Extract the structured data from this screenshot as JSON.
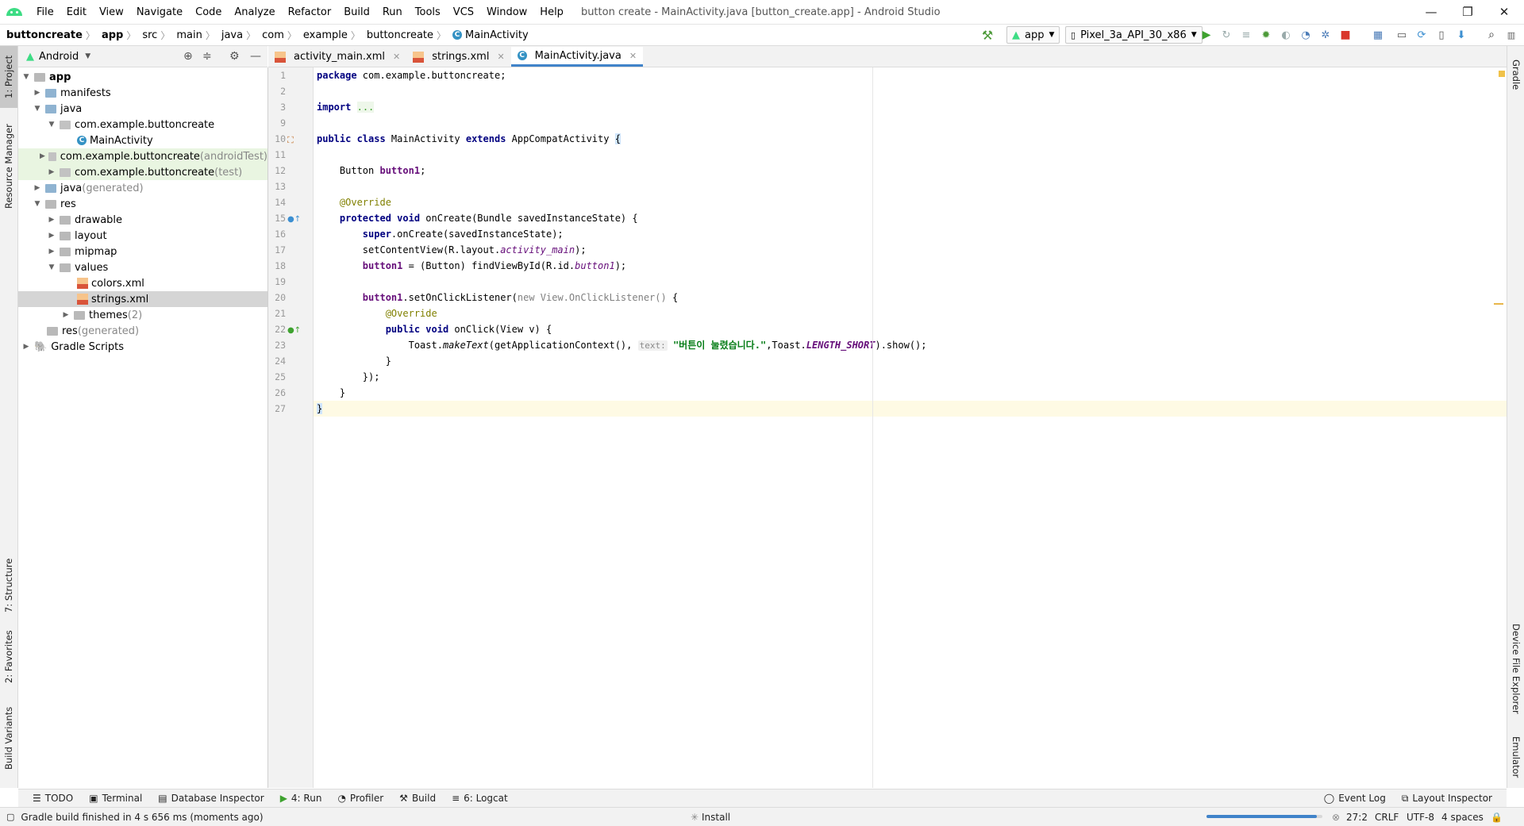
{
  "window": {
    "title": "button create - MainActivity.java [button_create.app] - Android Studio",
    "controls": {
      "minimize": "—",
      "restore": "❐",
      "close": "✕"
    }
  },
  "menu": [
    "File",
    "Edit",
    "View",
    "Navigate",
    "Code",
    "Analyze",
    "Refactor",
    "Build",
    "Run",
    "Tools",
    "VCS",
    "Window",
    "Help"
  ],
  "breadcrumb": [
    "buttoncreate",
    "app",
    "src",
    "main",
    "java",
    "com",
    "example",
    "buttoncreate",
    "MainActivity"
  ],
  "toolbar": {
    "run_config": "app",
    "device": "Pixel_3a_API_30_x86"
  },
  "project_panel": {
    "view_mode": "Android",
    "tree": [
      {
        "label": "app",
        "suffix": "",
        "bold": true
      },
      {
        "label": "manifests",
        "suffix": ""
      },
      {
        "label": "java",
        "suffix": ""
      },
      {
        "label": "com.example.buttoncreate",
        "suffix": ""
      },
      {
        "label": "MainActivity",
        "suffix": ""
      },
      {
        "label": "com.example.buttoncreate",
        "suffix": " (androidTest)"
      },
      {
        "label": "com.example.buttoncreate",
        "suffix": " (test)"
      },
      {
        "label": "java",
        "suffix": " (generated)"
      },
      {
        "label": "res",
        "suffix": ""
      },
      {
        "label": "drawable",
        "suffix": ""
      },
      {
        "label": "layout",
        "suffix": ""
      },
      {
        "label": "mipmap",
        "suffix": ""
      },
      {
        "label": "values",
        "suffix": ""
      },
      {
        "label": "colors.xml",
        "suffix": ""
      },
      {
        "label": "strings.xml",
        "suffix": ""
      },
      {
        "label": "themes",
        "suffix": " (2)"
      },
      {
        "label": "res",
        "suffix": " (generated)"
      },
      {
        "label": "Gradle Scripts",
        "suffix": ""
      }
    ]
  },
  "left_tool_tabs": [
    "1: Project",
    "Resource Manager",
    "7: Structure",
    "2: Favorites",
    "Build Variants"
  ],
  "right_tool_tabs": [
    "Gradle",
    "Device File Explorer",
    "Emulator"
  ],
  "editor_tabs": [
    {
      "label": "activity_main.xml"
    },
    {
      "label": "strings.xml"
    },
    {
      "label": "MainActivity.java",
      "active": true
    }
  ],
  "line_numbers": [
    "1",
    "2",
    "3",
    "9",
    "10",
    "11",
    "12",
    "13",
    "14",
    "15",
    "16",
    "17",
    "18",
    "19",
    "20",
    "21",
    "22",
    "23",
    "24",
    "25",
    "26",
    "27"
  ],
  "code": {
    "l1_kw": "package",
    "l1_rest": " com.example.buttoncreate;",
    "l3_kw": "import",
    "l3_fold": "...",
    "l10_kw1": "public class",
    "l10_mid": " MainActivity ",
    "l10_kw2": "extends",
    "l10_rest": " AppCompatActivity ",
    "l10_brace": "{",
    "l12_type": "Button ",
    "l12_field": "button1",
    "l12_end": ";",
    "l14_ann": "@Override",
    "l15_kw": "protected void",
    "l15_rest": " onCreate(Bundle savedInstanceState) {",
    "l16_kw": "super",
    "l16_rest": ".onCreate(savedInstanceState);",
    "l17_a": "setContentView(R.layout.",
    "l17_b": "activity_main",
    "l17_c": ");",
    "l18_a": "button1",
    "l18_b": " = (Button) findViewById(R.id.",
    "l18_c": "button1",
    "l18_d": ");",
    "l20_a": "button1",
    "l20_b": ".setOnClickListener(",
    "l20_c": "new View.OnClickListener()",
    "l20_d": " {",
    "l21_ann": "@Override",
    "l22_kw": "public void",
    "l22_rest": " onClick(View v) {",
    "l23_a": "Toast.",
    "l23_b": "makeText",
    "l23_c": "(getApplicationContext(), ",
    "l23_hint": "text:",
    "l23_str": "\"버튼이 눌렸습니다.\"",
    "l23_d": ",Toast.",
    "l23_e": "LENGTH_SHORT",
    "l23_f": ").show();",
    "l24": "}",
    "l25": "});",
    "l26": "}",
    "l27": "}"
  },
  "bottom_tools": {
    "left": [
      "TODO",
      "Terminal",
      "Database Inspector",
      "4: Run",
      "Profiler",
      "Build",
      "6: Logcat"
    ],
    "right": [
      "Event Log",
      "Layout Inspector"
    ]
  },
  "status": {
    "message": "Gradle build finished in 4 s 656 ms (moments ago)",
    "task": "Install",
    "progress": 0.95,
    "position": "27:2",
    "line_sep": "CRLF",
    "encoding": "UTF-8",
    "indent": "4 spaces"
  },
  "colors": {
    "accent": "#4083c9",
    "android_green": "#3ddc84",
    "highlight_row": "#e9f5e1"
  }
}
